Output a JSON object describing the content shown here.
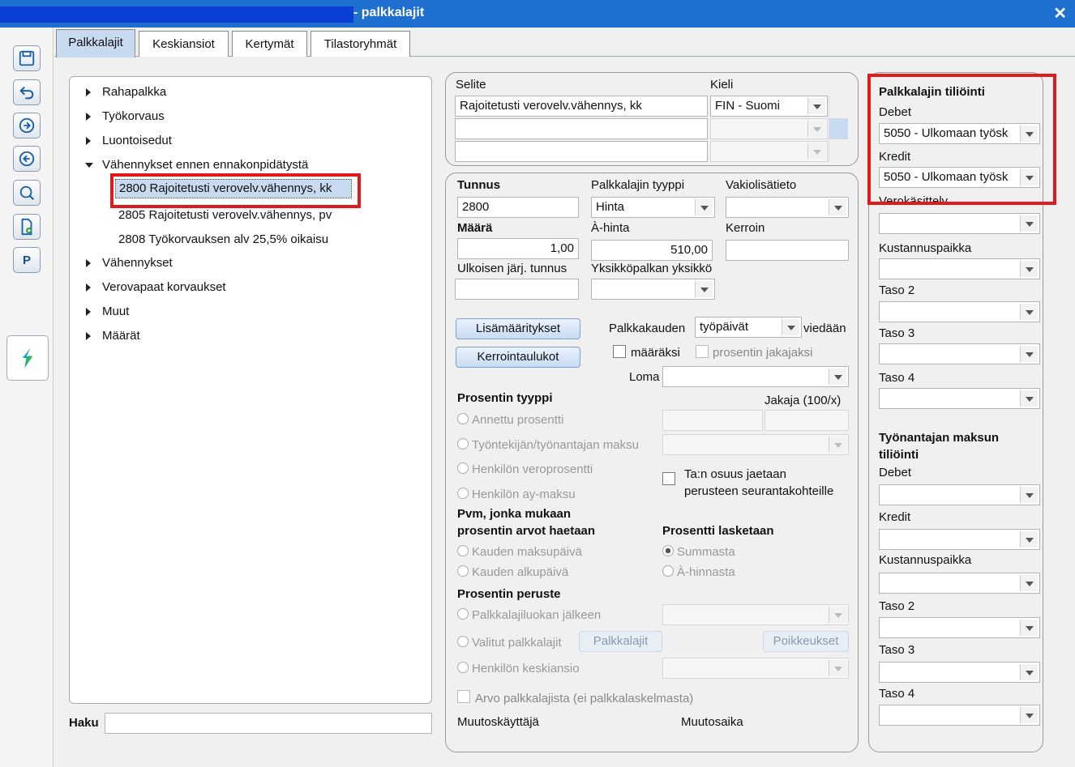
{
  "window": {
    "title": "- palkkalajit",
    "close": "✕"
  },
  "toolbar": {
    "p_label": "P"
  },
  "tabs": [
    "Palkkalajit",
    "Keskiansiot",
    "Kertymät",
    "Tilastoryhmät"
  ],
  "tree": {
    "items": [
      "Rahapalkka",
      "Työkorvaus",
      "Luontoisedut",
      "Vähennykset ennen ennakonpidätystä"
    ],
    "children": [
      "2800 Rajoitetusti verovelv.vähennys, kk",
      "2805 Rajoitetusti verovelv.vähennys, pv",
      "2808 Työkorvauksen alv 25,5% oikaisu"
    ],
    "items2": [
      "Vähennykset",
      "Verovapaat korvaukset",
      "Muut",
      "Määrät"
    ]
  },
  "search": {
    "label": "Haku",
    "value": ""
  },
  "desc": {
    "selite_label": "Selite",
    "kieli_label": "Kieli",
    "selite_value": "Rajoitetusti verovelv.vähennys, kk",
    "kieli_value": "FIN - Suomi"
  },
  "form": {
    "tunnus_label": "Tunnus",
    "tunnus": "2800",
    "tyyppi_label": "Palkkalajin tyyppi",
    "tyyppi": "Hinta",
    "vakio_label": "Vakiolisätieto",
    "maara_label": "Määrä",
    "maara": "1,00",
    "ahinta_label": "À-hinta",
    "ahinta": "510,00",
    "kerroin_label": "Kerroin",
    "ulk_label": "Ulkoisen järj. tunnus",
    "yks_label": "Yksikköpalkan yksikkö",
    "lisa_btn": "Lisämääritykset",
    "kerroin_btn": "Kerrointaulukot",
    "pk_label": "Palkkakauden",
    "pk_value": "työpäivät",
    "viedaan": "viedään",
    "maaraksi": "määräksi",
    "prosentin_jakajaksi": "prosentin jakajaksi",
    "loma_label": "Loma",
    "pros_tyyppi": "Prosentin tyyppi",
    "jakaja": "Jakaja (100/x)",
    "r_annettu": "Annettu prosentti",
    "r_tyontekija": "Työntekijän/työnantajan maksu",
    "r_veroprosentti": "Henkilön veroprosentti",
    "r_aymaksu": "Henkilön ay-maksu",
    "tan_osuus": "Ta:n osuus jaetaan",
    "perusteen": "perusteen seurantakohteille",
    "pvm_title1": "Pvm, jonka mukaan",
    "pvm_title2": "prosentin arvot haetaan",
    "pros_lask": "Prosentti lasketaan",
    "r_maksupaiva": "Kauden maksupäivä",
    "r_alkupaiva": "Kauden alkupäivä",
    "r_summasta": "Summasta",
    "r_ahinnasta": "À-hinnasta",
    "pros_peruste": "Prosentin peruste",
    "r_luokan": "Palkkalajiluokan jälkeen",
    "r_valitut": "Valitut palkkalajit",
    "btn_palkkalajit": "Palkkalajit",
    "btn_poikkeukset": "Poikkeukset",
    "r_keskiansio": "Henkilön keskiansio",
    "arvo": "Arvo palkkalajista (ei palkkalaskelmasta)",
    "muutoskayttaja": "Muutoskäyttäjä",
    "muutosaika": "Muutosaika"
  },
  "right": {
    "title": "Palkkalajin tiliöinti",
    "debet_label": "Debet",
    "debet": "5050 - Ulkomaan työsk",
    "kredit_label": "Kredit",
    "kredit": "5050 - Ulkomaan työsk",
    "verokasittely": "Verokäsittely",
    "kustannuspaikka": "Kustannuspaikka",
    "taso2": "Taso 2",
    "taso3": "Taso 3",
    "taso4": "Taso 4",
    "tyonantaja1": "Työnantajan maksun",
    "tyonantaja2": "tiliöinti",
    "debet2": "Debet",
    "kredit2": "Kredit",
    "kustannuspaikka2": "Kustannuspaikka",
    "taso2b": "Taso 2",
    "taso3b": "Taso 3",
    "taso4b": "Taso 4"
  },
  "colors": {
    "titlebar": "#1f6fd0",
    "highlight": "#e01b1b",
    "selected_bg": "#c7daf0"
  }
}
